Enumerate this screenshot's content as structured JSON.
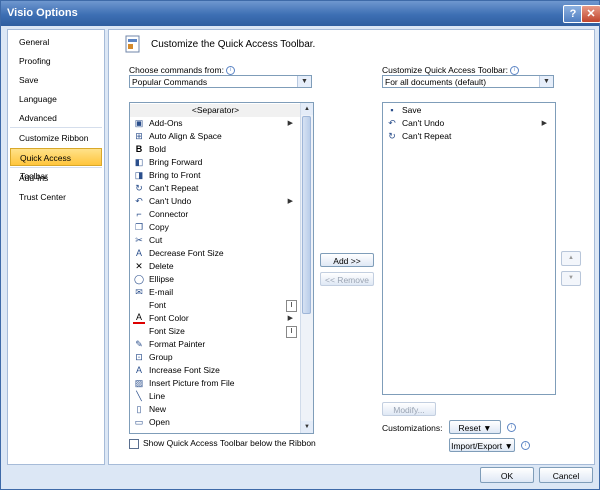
{
  "window": {
    "title": "Visio Options",
    "help_glyph": "?",
    "close_glyph": "✕"
  },
  "nav": {
    "items": [
      {
        "label": "General"
      },
      {
        "label": "Proofing"
      },
      {
        "label": "Save"
      },
      {
        "label": "Language"
      },
      {
        "label": "Advanced"
      },
      {
        "label": "Customize Ribbon"
      },
      {
        "label": "Quick Access Toolbar",
        "selected": true
      },
      {
        "label": "Add-Ins"
      },
      {
        "label": "Trust Center"
      }
    ]
  },
  "header": {
    "text": "Customize the Quick Access Toolbar."
  },
  "left": {
    "choose_label": "Choose commands from:",
    "choose_value": "Popular Commands",
    "commands": [
      {
        "label": "<Separator>",
        "icon": "separator"
      },
      {
        "label": "Add-Ons",
        "icon": "add-ons-icon",
        "submenu": true
      },
      {
        "label": "Auto Align & Space",
        "icon": "auto-align-icon"
      },
      {
        "label": "Bold",
        "icon": "bold-icon"
      },
      {
        "label": "Bring Forward",
        "icon": "bring-forward-icon"
      },
      {
        "label": "Bring to Front",
        "icon": "bring-to-front-icon"
      },
      {
        "label": "Can't Repeat",
        "icon": "repeat-icon"
      },
      {
        "label": "Can't Undo",
        "icon": "undo-icon",
        "submenu": true
      },
      {
        "label": "Connector",
        "icon": "connector-icon"
      },
      {
        "label": "Copy",
        "icon": "copy-icon"
      },
      {
        "label": "Cut",
        "icon": "cut-icon"
      },
      {
        "label": "Decrease Font Size",
        "icon": "decrease-font-icon"
      },
      {
        "label": "Delete",
        "icon": "delete-icon"
      },
      {
        "label": "Ellipse",
        "icon": "ellipse-icon"
      },
      {
        "label": "E-mail",
        "icon": "email-icon"
      },
      {
        "label": "Font",
        "icon": "",
        "combo": true
      },
      {
        "label": "Font Color",
        "icon": "font-color-icon",
        "submenu": true
      },
      {
        "label": "Font Size",
        "icon": "",
        "combo": true
      },
      {
        "label": "Format Painter",
        "icon": "format-painter-icon"
      },
      {
        "label": "Group",
        "icon": "group-icon"
      },
      {
        "label": "Increase Font Size",
        "icon": "increase-font-icon"
      },
      {
        "label": "Insert Picture from File",
        "icon": "insert-picture-icon"
      },
      {
        "label": "Line",
        "icon": "line-icon"
      },
      {
        "label": "New",
        "icon": "new-icon"
      },
      {
        "label": "Open",
        "icon": "open-icon"
      }
    ],
    "show_below_label": "Show Quick Access Toolbar below the Ribbon"
  },
  "middle": {
    "add_label": "Add >>",
    "remove_label": "<< Remove"
  },
  "right": {
    "customize_label": "Customize Quick Access Toolbar:",
    "customize_value": "For all documents (default)",
    "items": [
      {
        "label": "Save",
        "icon": "save-icon"
      },
      {
        "label": "Can't Undo",
        "icon": "undo-icon",
        "submenu": true
      },
      {
        "label": "Can't Repeat",
        "icon": "repeat-icon"
      }
    ],
    "modify_label": "Modify...",
    "customizations_label": "Customizations:",
    "reset_label": "Reset ▼",
    "import_export_label": "Import/Export ▼"
  },
  "footer": {
    "ok_label": "OK",
    "cancel_label": "Cancel"
  },
  "colors": {
    "accent": "#3d6fb4",
    "selected": "#ffc53d"
  }
}
